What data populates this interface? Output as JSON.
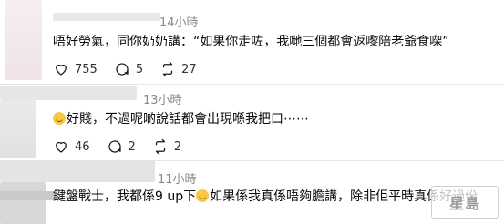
{
  "comments": [
    {
      "time": "14小時",
      "text": "唔好勞氣，同你奶奶講：“如果你走咗，我哋三個都會返嚟陪老爺食㗎”",
      "likes": "755",
      "replies": "5",
      "reposts": "27"
    },
    {
      "time": "13小時",
      "emoji": "laughing-emoji",
      "text": "好賤，不過呢啲說話都會出現喺我把口⋯⋯",
      "likes": "46",
      "replies": "2",
      "reposts": "2"
    },
    {
      "time": "11小時",
      "text_part1": "鍵盤戰士，我都係9 up下",
      "emoji": "laughing-emoji",
      "text_part2": "如果係我真係唔夠膽講，除非佢平時真係好過份"
    }
  ],
  "watermark": {
    "text": "星島"
  },
  "icons": {
    "like": "heart-icon",
    "reply": "comment-icon",
    "repost": "repost-icon"
  }
}
